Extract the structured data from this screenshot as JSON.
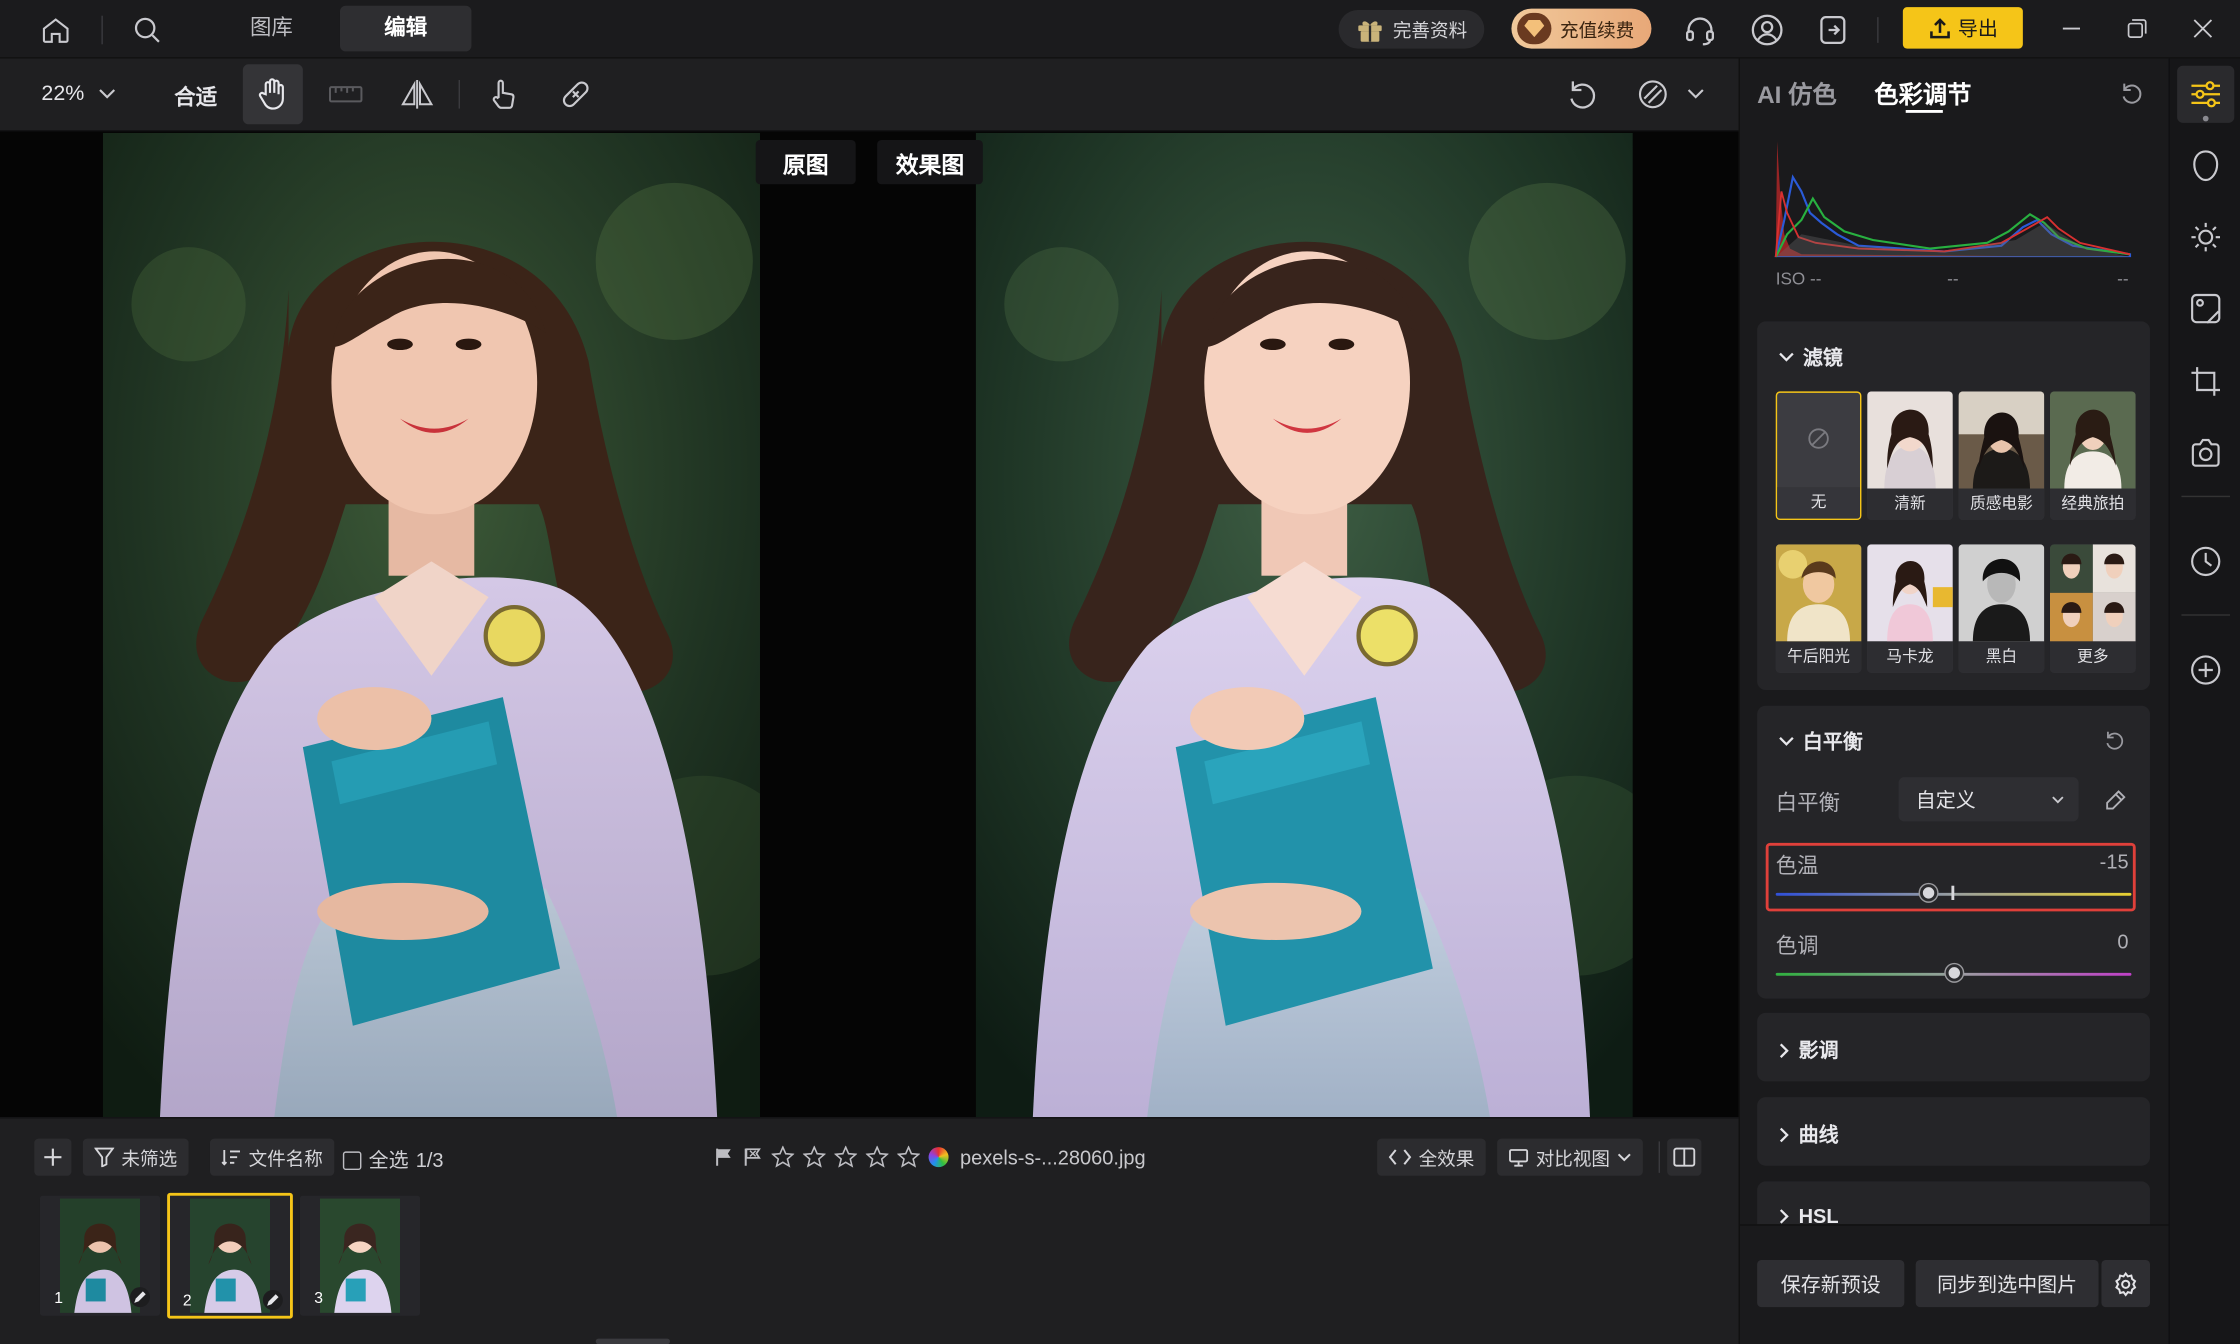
{
  "topbar": {
    "tabs": [
      "图库",
      "编辑"
    ],
    "active_tab": "编辑",
    "profile_label": "完善资料",
    "vip_label": "充值续费",
    "export_label": "导出"
  },
  "toolbar": {
    "zoom": "22%",
    "fit_label": "合适"
  },
  "canvas": {
    "original_label": "原图",
    "effect_label": "效果图"
  },
  "filmstrip": {
    "filter_label": "未筛选",
    "sort_label": "文件名称",
    "select_all_label": "全选",
    "selection_count": "1/3",
    "filename": "pexels-s-...28060.jpg",
    "all_effects_label": "全效果",
    "compare_view_label": "对比视图",
    "thumbnails": [
      "1",
      "2",
      "3"
    ],
    "selected_index": 2
  },
  "panel": {
    "tabs": [
      "AI 仿色",
      "色彩调节"
    ],
    "active_tab": "色彩调节",
    "histogram": {
      "iso": "ISO --",
      "mid": "--",
      "right": "--"
    },
    "filter_section": {
      "title": "滤镜",
      "items": [
        "无",
        "清新",
        "质感电影",
        "经典旅拍",
        "午后阳光",
        "马卡龙",
        "黑白",
        "更多"
      ]
    },
    "white_balance": {
      "title": "白平衡",
      "label": "白平衡",
      "mode": "自定义",
      "temperature": {
        "label": "色温",
        "value": "-15",
        "position": 0.43
      },
      "tint": {
        "label": "色调",
        "value": "0",
        "position": 0.5
      }
    },
    "collapsed_sections": [
      "影调",
      "曲线",
      "HSL"
    ],
    "save_preset_label": "保存新预设",
    "sync_label": "同步到选中图片"
  },
  "colors": {
    "accent": "#f5c518",
    "highlight_box": "#e0403a",
    "panel_bg": "#1a1a1c"
  }
}
